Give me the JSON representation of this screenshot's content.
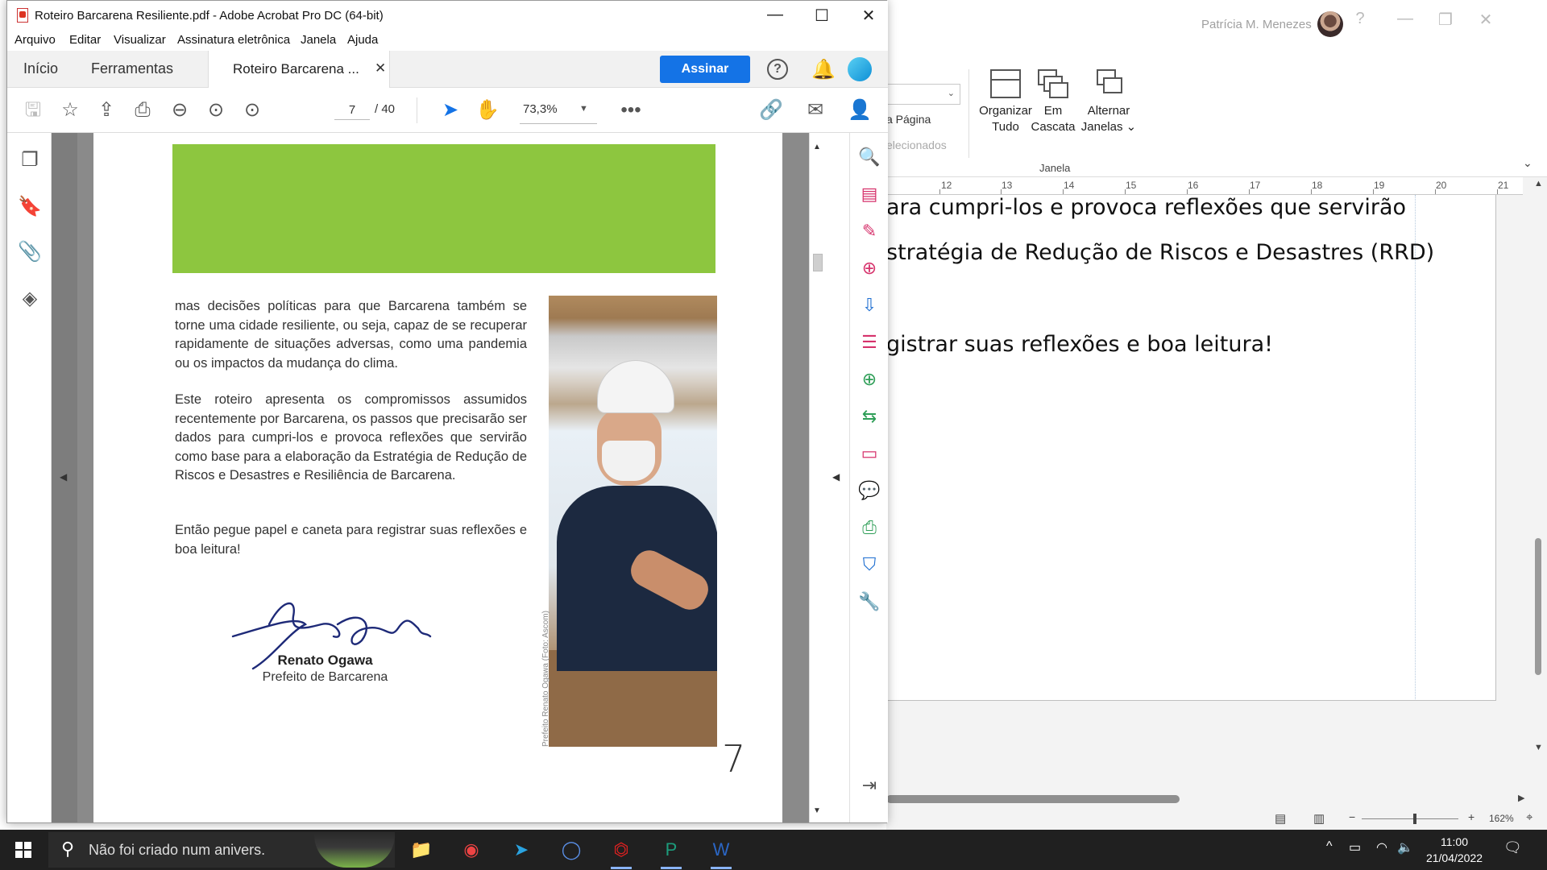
{
  "word": {
    "user_name": "Patrícia M. Menezes",
    "ribbon": {
      "partial_page_label": "a Página",
      "partial_selected_label": "elecionados",
      "arrange_all_label_1": "Organizar",
      "arrange_all_label_2": "Tudo",
      "cascade_label_1": "Em",
      "cascade_label_2": "Cascata",
      "switch_label_1": "Alternar",
      "switch_label_2": "Janelas",
      "group_label": "Janela"
    },
    "ruler_numbers": [
      "12",
      "13",
      "14",
      "15",
      "16",
      "17",
      "18",
      "19",
      "20",
      "21"
    ],
    "doc_lines": [
      "ara cumpri-los e provoca reflexões que servirão",
      "stratégia de Redução de Riscos e Desastres (RRD)",
      "gistrar suas reflexões e boa leitura!"
    ],
    "zoom_level": "162%"
  },
  "acrobat": {
    "title": "Roteiro Barcarena Resiliente.pdf - Adobe Acrobat Pro DC (64-bit)",
    "menu": [
      "Arquivo",
      "Editar",
      "Visualizar",
      "Assinatura eletrônica",
      "Janela",
      "Ajuda"
    ],
    "tabs": {
      "home": "Início",
      "tools": "Ferramentas",
      "document": "Roteiro Barcarena ..."
    },
    "sign_button": "Assinar",
    "current_page": "7",
    "total_pages": "/ 40",
    "zoom": "73,3%",
    "page": {
      "paragraph_1": "mas decisões políticas para que Barcarena também se torne uma cidade resiliente, ou seja, capaz de se recuperar rapidamente de situações adversas, como uma pandemia ou os impactos da mudança do clima.",
      "paragraph_2": "Este roteiro apresenta os compromissos assumidos recentemente por Barcarena, os passos que precisarão ser dados para cumpri-los e provoca reflexões que servirão como base para a elaboração da Estratégia de Redução de Riscos e Desastres e Resiliência de Barcarena.",
      "paragraph_3": "Então pegue papel e caneta para registrar suas reflexões e boa leitura!",
      "photo_credit": "Prefeito Renato Ogawa (Foto: Ascom)",
      "signer_name": "Renato Ogawa",
      "signer_role": "Prefeito de Barcarena",
      "page_number": "7"
    }
  },
  "taskbar": {
    "search_text": "Não foi criado num anivers.",
    "time": "11:00",
    "date": "21/04/2022"
  },
  "colors": {
    "accent_blue": "#1473e6",
    "green_band": "#8dc63f",
    "tool_pink": "#d6336c",
    "tool_blue": "#1f6fd1",
    "tool_green": "#2e9e57"
  }
}
